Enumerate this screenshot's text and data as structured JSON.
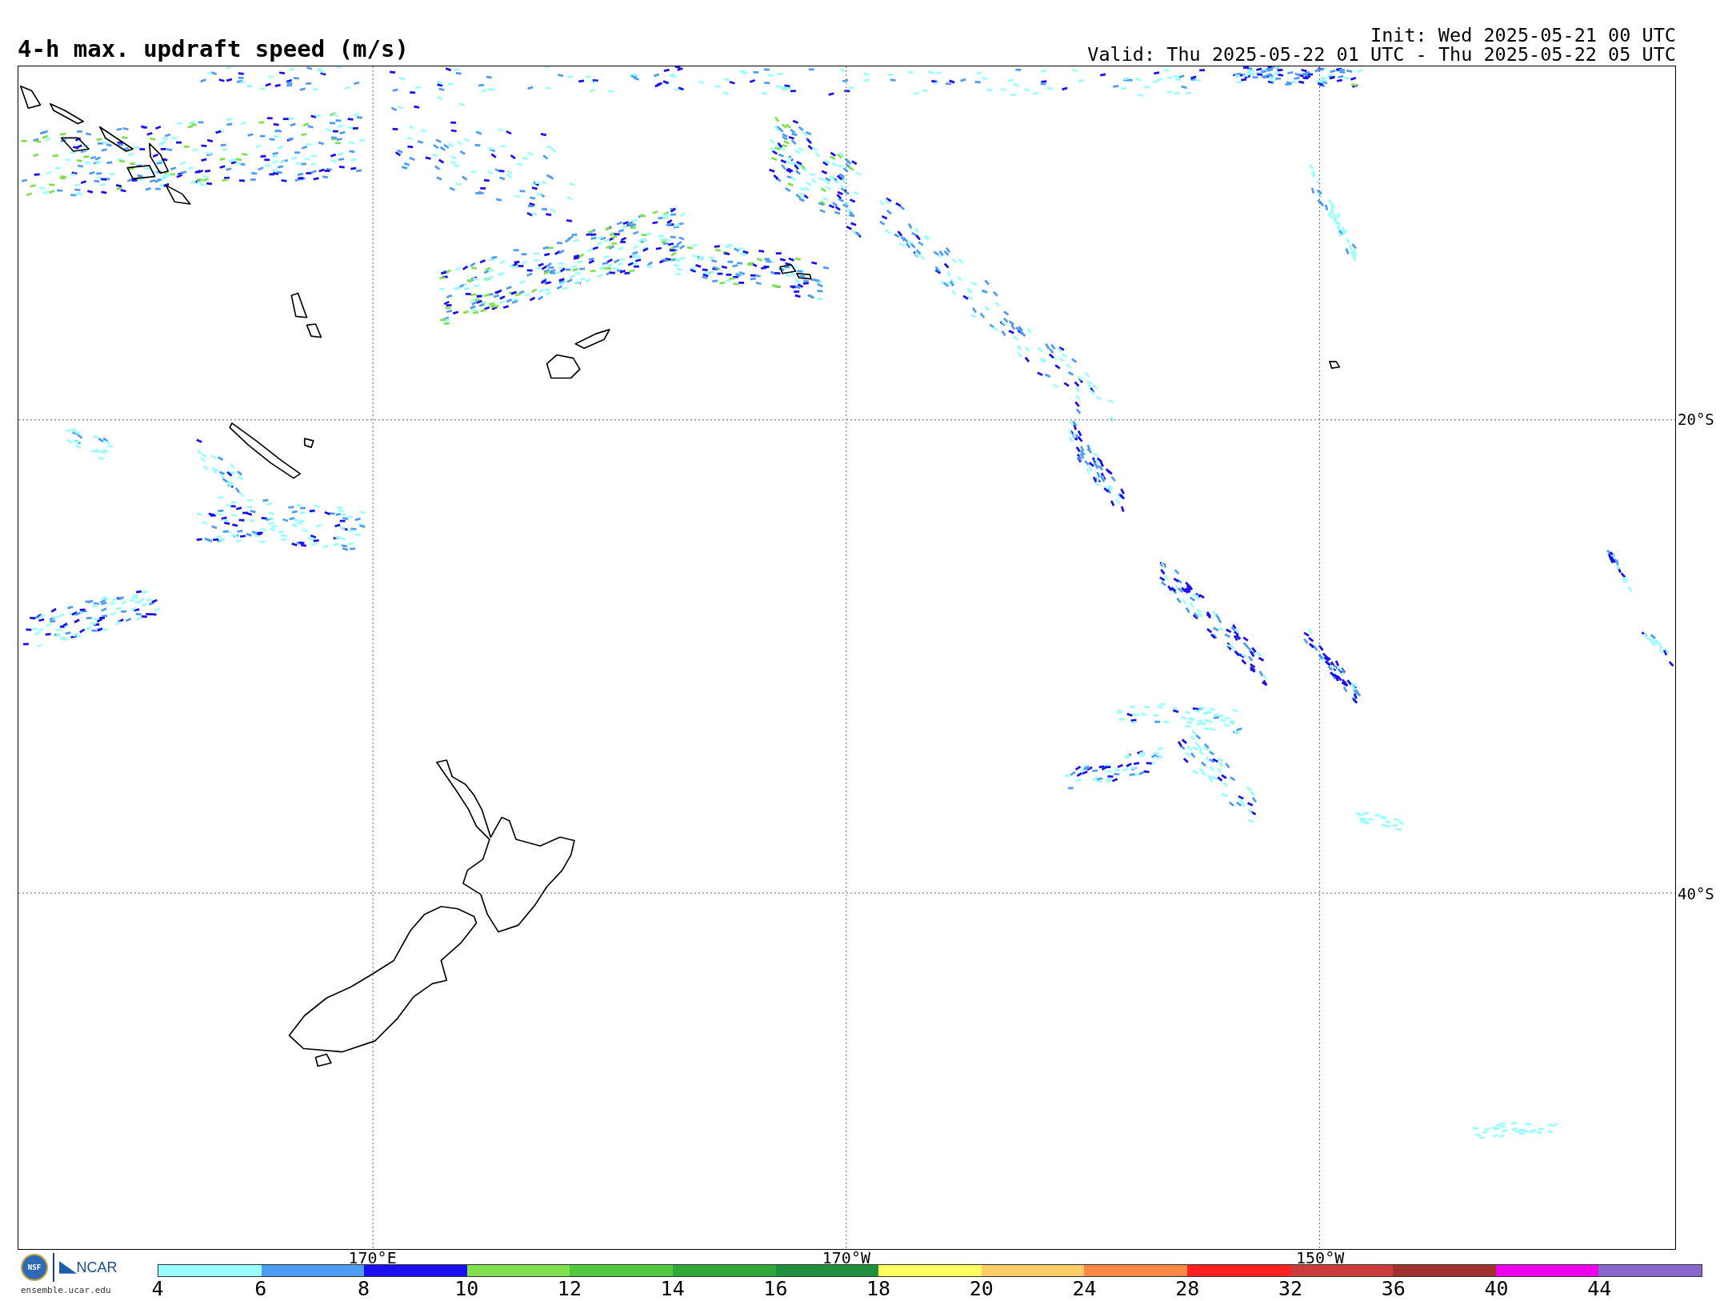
{
  "title": "4-h max. updraft speed (m/s)",
  "init": "Init: Wed 2025-05-21 00 UTC",
  "valid": "Valid: Thu 2025-05-22 01 UTC - Thu 2025-05-22 05 UTC",
  "map": {
    "longitude_labels": [
      "170°E",
      "170°W",
      "150°W"
    ],
    "latitude_labels": [
      "20°S",
      "40°S"
    ]
  },
  "colorbar": {
    "segments": [
      {
        "color": "#99ffff"
      },
      {
        "color": "#4f9cf7"
      },
      {
        "color": "#1a0ff0"
      },
      {
        "color": "#80e050"
      },
      {
        "color": "#50c840"
      },
      {
        "color": "#30a838"
      },
      {
        "color": "#209040"
      },
      {
        "color": "#ffff60"
      },
      {
        "color": "#ffcc66"
      },
      {
        "color": "#ff8844"
      },
      {
        "color": "#ff2020"
      },
      {
        "color": "#cc3c3c"
      },
      {
        "color": "#a03030"
      },
      {
        "color": "#ee00ee"
      },
      {
        "color": "#8866cc"
      }
    ],
    "ticks": [
      "4",
      "6",
      "8",
      "10",
      "12",
      "14",
      "16",
      "18",
      "20",
      "24",
      "28",
      "32",
      "36",
      "40",
      "44"
    ]
  },
  "footer": {
    "seal": "NSF",
    "org": "NCAR",
    "url": "ensemble.ucar.edu"
  }
}
